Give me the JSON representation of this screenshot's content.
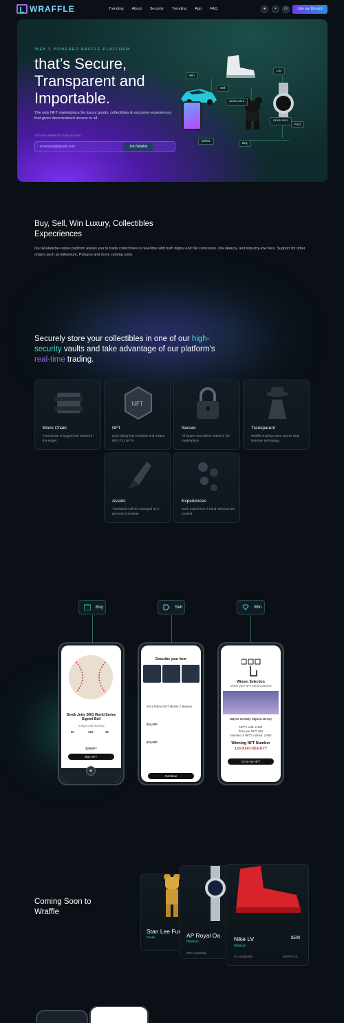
{
  "nav": {
    "logo": "WRAFFLE",
    "links": [
      "Trending",
      "About",
      "Security",
      "Trending",
      "App",
      "FAQ"
    ],
    "discord": "Join our Discord"
  },
  "hero": {
    "kicker": "WEB 3 POWERED RAFFLE PLATFORM",
    "title": "that’s Secure, Transparent and Importable.",
    "description": "The only NFT marketplace for luxury goods, collectibles & exclusive experiences that gives decentralized access to all.",
    "waitlist_label": "Join the waitlist for early access",
    "email_placeholder": "example@gmail.com",
    "join_button": "Join Waitlist",
    "nodes": {
      "win": "Win",
      "sell": "Sell",
      "list": "List",
      "select": "Select",
      "buy": "Buy",
      "find": "Find",
      "code1": "OEK11X313",
      "code2": "OEK11X313"
    }
  },
  "buysell": {
    "heading": "Buy, Sell, Win Luxury, Collectibles Expecriences",
    "body": "Our Avalanche-native platform allows you to trade collectibles in real-time with both digital and fiat currencies, low latency, and industry-low fees. Support for other chains such as Ethereum, Polygon and more coming soon."
  },
  "security": {
    "heading_1": "Securely store your collectibles in one of our",
    "heading_hl1": "high-security",
    "heading_2": " vaults and take advantage of",
    "heading_3": "our platform’s ",
    "heading_hl2": "real-time",
    "heading_4": " trading.",
    "cards": [
      {
        "title": "Block Chain",
        "desc": "Transaction is logged and tracked in the ledger"
      },
      {
        "title": "NFT",
        "desc": "Each listing has exclusive and unique ERC-721 NFTs"
      },
      {
        "title": "Secure",
        "desc": "All buyers and sellers vetted in the marketplace"
      },
      {
        "title": "Transparent",
        "desc": "Wraffle employs open source Real Random technology"
      },
      {
        "title": "Assets",
        "desc": "Transaction will be managed by a personal concierge"
      },
      {
        "title": "Experiences",
        "desc": "Each experience is hand selected and curated"
      }
    ]
  },
  "flow": {
    "pills": [
      "Buy",
      "Sell",
      "Win"
    ],
    "buy": {
      "title": "Derek Jeter 2001 World Series Signed Ball",
      "sub": "8 days until drawing",
      "stats": [
        "20",
        "120",
        "35"
      ],
      "price": "$25/NFT",
      "cta": "Buy NFT"
    },
    "sell": {
      "title": "Describe your item",
      "item": "2021 Rolex GMT Master 2 Batman",
      "price1": "$24,000",
      "price2": "$20,500",
      "cta": "Continue"
    },
    "win": {
      "title": "Winner Selection",
      "sub": "Check your NFT serial numbers",
      "item": "Wayne Gretzky Signed Jersey",
      "stats": "NFT's sold: 2,225",
      "price": "Price per NFT: $10",
      "minted": "Number of NFT's minted: 2,660",
      "nft_label": "Winning NFT Number",
      "nft_number": "123-X247-353-KY7",
      "cta": "Go to my NFT"
    }
  },
  "coming": {
    "heading": "Coming Soon to Wraffle",
    "cards": [
      {
        "name": "Stan Lee Fun",
        "sub": "Funko"
      },
      {
        "name": "AP Royal Oa",
        "sub": "Platinum",
        "avail": "300 Availability"
      },
      {
        "name": "Nike LV",
        "sub": "Platinum",
        "price": "$500",
        "avail": "20 Availability",
        "brand": "WRAFFLE"
      }
    ]
  }
}
